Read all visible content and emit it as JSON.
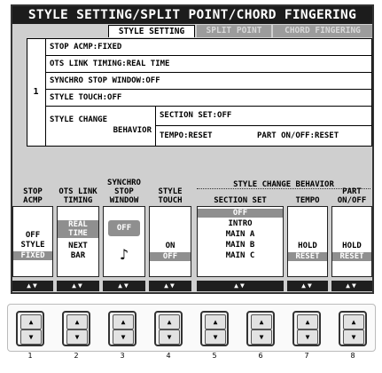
{
  "screen": {
    "title": "STYLE SETTING/SPLIT POINT/CHORD FINGERING",
    "tabs": [
      {
        "label": "STYLE SETTING",
        "active": true
      },
      {
        "label": "SPLIT POINT",
        "active": false
      },
      {
        "label": "CHORD FINGERING",
        "active": false
      }
    ]
  },
  "settings": {
    "row_number": "1",
    "rows": [
      "STOP ACMP:FIXED",
      "OTS LINK TIMING:REAL TIME",
      "SYNCHRO STOP WINDOW:OFF",
      "STYLE TOUCH:OFF"
    ],
    "change_behavior": {
      "label_line1": "STYLE CHANGE",
      "label_line2": "BEHAVIOR",
      "section_set": "SECTION SET:OFF",
      "tempo": "TEMPO:RESET",
      "part": "PART ON/OFF:RESET"
    }
  },
  "controls": {
    "group_header": "STYLE CHANGE BEHAVIOR",
    "columns": [
      {
        "label1": "STOP",
        "label2": "ACMP",
        "options": [
          "OFF",
          "STYLE",
          "FIXED"
        ],
        "selected": 2
      },
      {
        "label1": "OTS LINK",
        "label2": "TIMING",
        "options": [
          "REAL",
          "TIME",
          "NEXT",
          "BAR"
        ],
        "selected": 0
      },
      {
        "label0": "SYNCHRO",
        "label1": "STOP",
        "label2": "WINDOW",
        "options": [
          "OFF"
        ],
        "selected": 0
      },
      {
        "label1": "STYLE",
        "label2": "TOUCH",
        "options": [
          "ON",
          "OFF"
        ],
        "selected": 1
      },
      {
        "label1": "",
        "label2": "SECTION SET",
        "options": [
          "OFF",
          "INTRO",
          "MAIN A",
          "MAIN B",
          "MAIN C"
        ],
        "selected": 0
      },
      {
        "label1": "",
        "label2": "TEMPO",
        "options": [
          "HOLD",
          "RESET"
        ],
        "selected": 1
      },
      {
        "label1": "PART",
        "label2": "ON/OFF",
        "options": [
          "HOLD",
          "RESET"
        ],
        "selected": 1
      }
    ]
  },
  "buttons": [
    "1",
    "2",
    "3",
    "4",
    "5",
    "6",
    "7",
    "8"
  ],
  "colors": {
    "title_bg": "#1c1c1c",
    "lcd_bg": "#cfcfcf",
    "highlight": "#8f8f8f"
  }
}
